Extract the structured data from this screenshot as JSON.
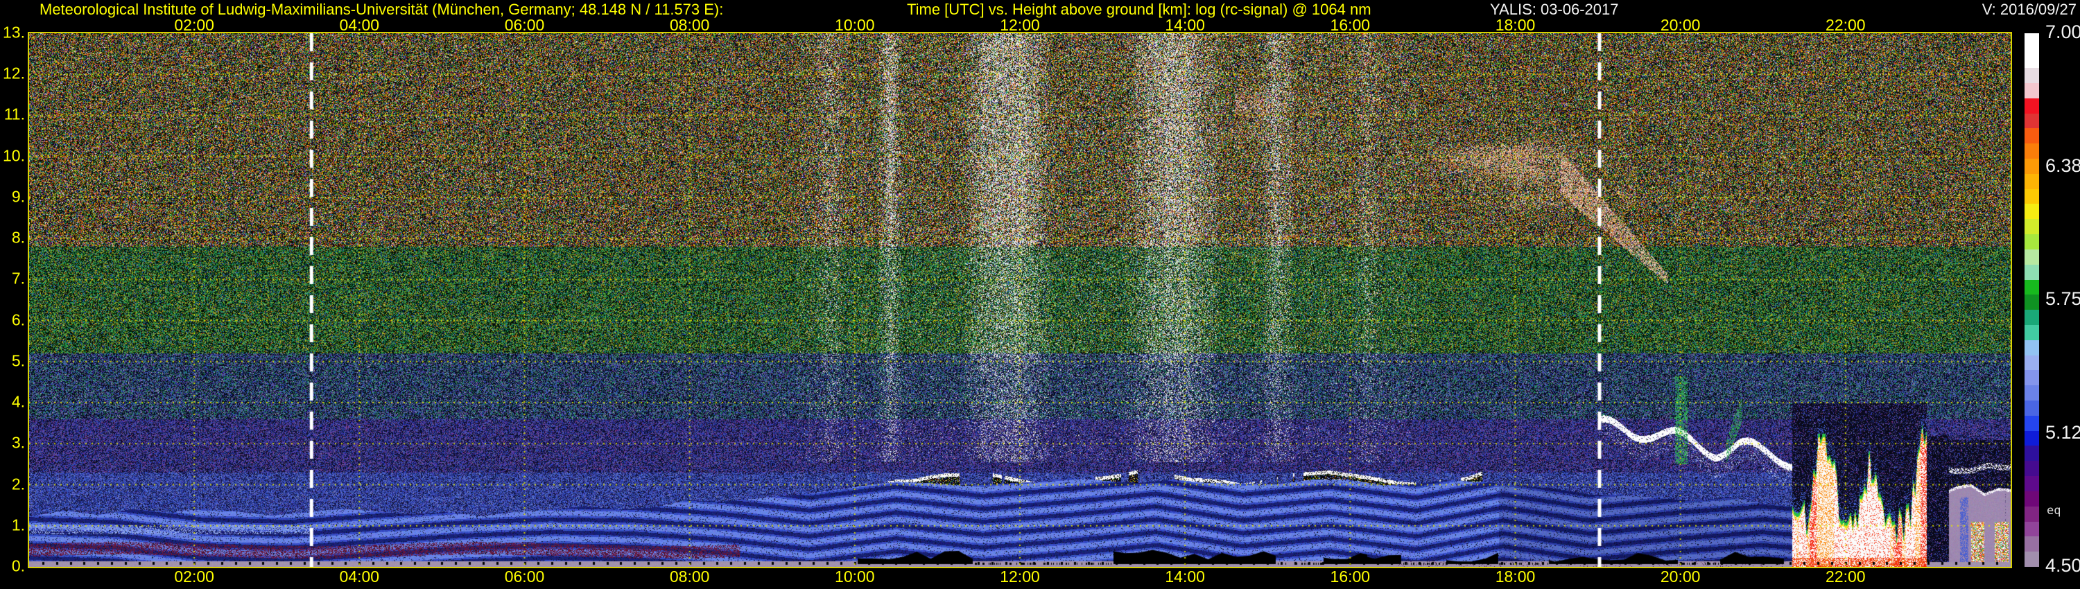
{
  "header": {
    "left_title": "Meteorological Institute of Ludwig-Maximilians-Universität (München, Germany; 48.148 N / 11.573 E):",
    "center_title": "Time [UTC] vs. Height above ground [km]: log (rc-signal) @ 1064 nm",
    "instrument_date": "YALIS: 03-06-2017",
    "version": "V: 2016/09/27"
  },
  "axes": {
    "x_range_hours": [
      0,
      24
    ],
    "y_range_km": [
      0,
      13
    ],
    "x_ticks": [
      {
        "label": "02:00",
        "hour": 2
      },
      {
        "label": "04:00",
        "hour": 4
      },
      {
        "label": "06:00",
        "hour": 6
      },
      {
        "label": "08:00",
        "hour": 8
      },
      {
        "label": "10:00",
        "hour": 10
      },
      {
        "label": "12:00",
        "hour": 12
      },
      {
        "label": "14:00",
        "hour": 14
      },
      {
        "label": "16:00",
        "hour": 16
      },
      {
        "label": "18:00",
        "hour": 18
      },
      {
        "label": "20:00",
        "hour": 20
      },
      {
        "label": "22:00",
        "hour": 22
      }
    ],
    "y_ticks": [
      {
        "label": "13.",
        "km": 13
      },
      {
        "label": "12.",
        "km": 12
      },
      {
        "label": "11.",
        "km": 11
      },
      {
        "label": "10.",
        "km": 10
      },
      {
        "label": "9.",
        "km": 9
      },
      {
        "label": "8.",
        "km": 8
      },
      {
        "label": "7.",
        "km": 7
      },
      {
        "label": "6.",
        "km": 6
      },
      {
        "label": "5.",
        "km": 5
      },
      {
        "label": "4.",
        "km": 4
      },
      {
        "label": "3.",
        "km": 3
      },
      {
        "label": "2.",
        "km": 2
      },
      {
        "label": "1.",
        "km": 1
      },
      {
        "label": "0.",
        "km": 0
      }
    ]
  },
  "colorbar": {
    "tick_labels": [
      {
        "label": "7.00",
        "frac": 0.0
      },
      {
        "label": "6.38",
        "frac": 0.25
      },
      {
        "label": "5.75",
        "frac": 0.5
      },
      {
        "label": "5.12",
        "frac": 0.75
      },
      {
        "label": "4.50",
        "frac": 1.0
      }
    ],
    "side_note": "eq",
    "colors": [
      "#ffffff",
      "#e8dde3",
      "#f3c7ce",
      "#f31322",
      "#e03434",
      "#f85c10",
      "#fa7e0a",
      "#fc9a07",
      "#fdb405",
      "#fdca04",
      "#f6ec12",
      "#d2ec2b",
      "#a8e83e",
      "#b7e9a1",
      "#8edeb2",
      "#17b91e",
      "#0f9222",
      "#1aa878",
      "#42cba2",
      "#92c3f2",
      "#9aaff0",
      "#8495ec",
      "#6b82e8",
      "#4a66e4",
      "#2545ee",
      "#0f1cd8",
      "#2e109e",
      "#450b90",
      "#5e0a8c",
      "#6f0878",
      "#812583",
      "#91449a",
      "#9870a2",
      "#a28fae"
    ]
  },
  "chart_data": {
    "type": "heatmap",
    "title": "Time [UTC] vs. Height above ground [km]: log (rc-signal) @ 1064 nm",
    "station": "Meteorological Institute LMU München, 48.148 N / 11.573 E",
    "instrument": "YALIS",
    "date": "03-06-2017",
    "xlabel": "Time [UTC]",
    "ylabel": "Height above ground [km]",
    "x_range_hours": [
      0,
      24
    ],
    "y_range_km": [
      0,
      13
    ],
    "colorbar_label_values": [
      7.0,
      6.38,
      5.75,
      5.12,
      4.5
    ],
    "colorbar_range": [
      4.5,
      7.0
    ],
    "grid": "yellow dotted, every 2 h and every 1 km",
    "features": [
      {
        "name": "sunrise_marker_line",
        "time_utc": 3.42,
        "style": "white dashed vertical"
      },
      {
        "name": "sunset_marker_line",
        "time_utc": 19.02,
        "style": "white dashed vertical"
      },
      {
        "name": "incomplete_overlap_surface_band",
        "time_utc": [
          0,
          24
        ],
        "top_km": 0.14,
        "color": "mauve"
      },
      {
        "name": "nocturnal_aerosol_layers",
        "time_utc": [
          0,
          8.6
        ],
        "height_km": [
          0.15,
          1.3
        ],
        "note": "layered blue with dark-red sublayer 0.25-0.6 km"
      },
      {
        "name": "boundary_layer_top_km",
        "time_utc": [
          0,
          6,
          10.5,
          17,
          21
        ],
        "top_km": [
          1.32,
          1.32,
          2.07,
          2.07,
          1.6
        ]
      },
      {
        "name": "shallow_cumulus_line",
        "time_utc": [
          10.4,
          17.6
        ],
        "base_km": 2.1,
        "note": "black cloud blobs with white caps"
      },
      {
        "name": "daytime_background_noise_columns",
        "time_utc": [
          9.3,
          16.8
        ],
        "note": "white speckle bursts 10:15-10:36, 11:15-12:27, 13:12-14:30, 14:54-15:21"
      },
      {
        "name": "cirrus_deck",
        "time_utc": [
          14.7,
          19.4
        ],
        "height_km": [
          9.0,
          11.6
        ],
        "color": "tan/pink wisps"
      },
      {
        "name": "descending_cirrus_streak",
        "time_utc": [
          18.55,
          19.85
        ],
        "height_km": [
          9.6,
          7.0
        ]
      },
      {
        "name": "evening_stratocumulus",
        "time_utc": [
          19.0,
          21.5
        ],
        "height_km": [
          3.6,
          2.6
        ],
        "note": "bright white cloud line, green fall streak near 20:00"
      },
      {
        "name": "rain_showers",
        "time_utc": [
          21.4,
          23.3
        ],
        "top_km": 3.4,
        "reaches_ground": true,
        "note": "white/red cores, yellow-green edges, blue fringe"
      },
      {
        "name": "post_rain_mauve_fill",
        "time_utc": [
          23.25,
          24
        ],
        "top_km": 1.9,
        "note": "attenuated mauve with blue streaks, white caps"
      },
      {
        "name": "status_flag_trace",
        "time_utc": [
          10.05,
          21.25
        ],
        "note": "black bumps just above bottom axis"
      },
      {
        "name": "minor_time_ticks",
        "interval_min": 10,
        "style": "small black marks above bottom axis"
      }
    ]
  },
  "plot": {
    "grid_color": "#e6e600",
    "sun_lines_utc": [
      3.42,
      19.02
    ],
    "day_noise": {
      "start": 9.3,
      "end": 16.8
    },
    "day_bursts": [
      [
        9.5,
        9.9,
        0.5
      ],
      [
        10.25,
        10.6,
        0.9
      ],
      [
        11.25,
        12.45,
        1.0
      ],
      [
        13.2,
        14.5,
        0.95
      ],
      [
        14.9,
        15.35,
        0.7
      ],
      [
        16.0,
        16.4,
        0.4
      ]
    ]
  }
}
